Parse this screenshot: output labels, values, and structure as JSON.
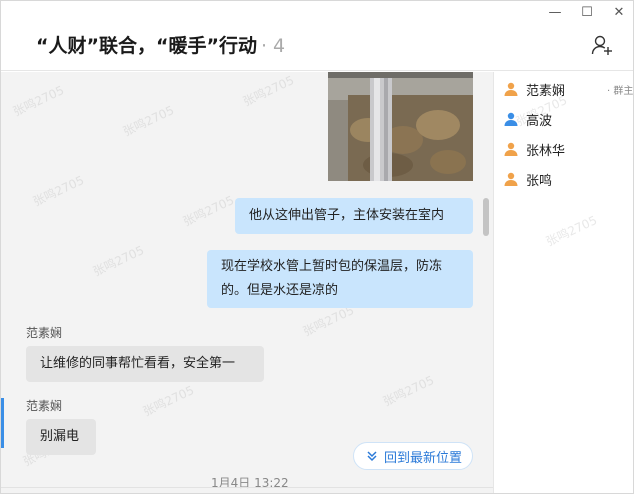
{
  "window": {
    "controls": {
      "minimize": "—",
      "maximize": "☐",
      "close": "✕"
    }
  },
  "header": {
    "title": "“人财”联合，“暖手”行动",
    "member_count": "· 4",
    "add_member_icon": "add-person-icon"
  },
  "messages": [
    {
      "from": "me",
      "type": "image",
      "alt_icon": "photo"
    },
    {
      "from": "me",
      "text": "他从这伸出管子，主体安装在室内"
    },
    {
      "from": "me",
      "text_line1": "现在学校水管上暂时包的保温层，防冻",
      "text_line2": "的。但是水还是凉的"
    },
    {
      "from": "other",
      "sender": "范素娴",
      "text": "让维修的同事帮忙看看，安全第一"
    },
    {
      "from": "other",
      "sender": "范素娴",
      "text": "别漏电"
    }
  ],
  "jump_latest": {
    "label": "回到最新位置",
    "icon": "double-chevron-down-icon"
  },
  "timestamp": "1月4日 13:22",
  "members": [
    {
      "name": "范素娴",
      "tag": "· 群主",
      "color": "#f0a24a"
    },
    {
      "name": "高波",
      "tag": "",
      "color": "#3a8ee6"
    },
    {
      "name": "张林华",
      "tag": "",
      "color": "#f0a24a"
    },
    {
      "name": "张鸣",
      "tag": "",
      "color": "#f0a24a"
    }
  ],
  "watermark": "张鸣2705"
}
